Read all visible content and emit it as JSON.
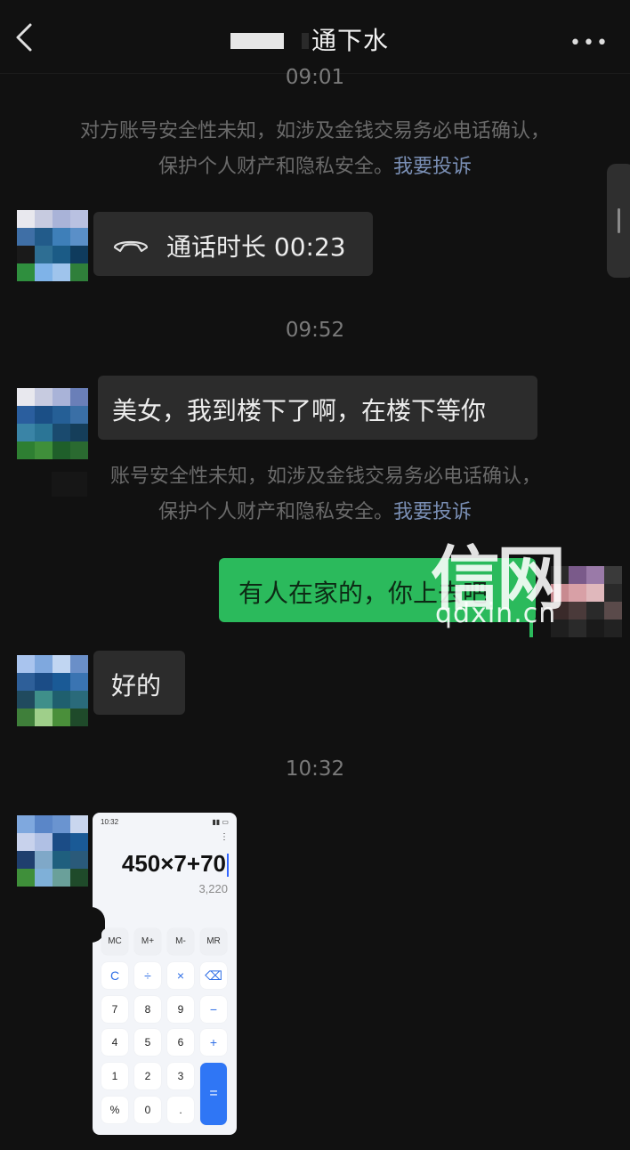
{
  "header": {
    "title": "通下水",
    "more_label": "•••"
  },
  "timestamps": [
    "09:01",
    "09:52",
    "10:32"
  ],
  "notice_1": {
    "line1": "对方账号安全性未知，如涉及金钱交易务必电话确认，",
    "line2_prefix": "保护个人财产和隐私安全。",
    "link": "我要投诉"
  },
  "notice_2": {
    "line1": "账号安全性未知，如涉及金钱交易务必电话确认，",
    "line2_prefix": "保护个人财产和隐私安全。",
    "link": "我要投诉"
  },
  "messages": [
    {
      "side": "left",
      "type": "call",
      "text": "通话时长 00:23"
    },
    {
      "side": "left",
      "type": "text",
      "text": "美女，我到楼下了啊，在楼下等你"
    },
    {
      "side": "right",
      "type": "text",
      "text": "有人在家的，你上去吧"
    },
    {
      "side": "left",
      "type": "text",
      "text": "好的"
    },
    {
      "side": "left",
      "type": "image",
      "text": ""
    }
  ],
  "watermark": {
    "big": "信网",
    "small": "qdxin.cn"
  },
  "calculator": {
    "status_time": "10:32",
    "status_icons": "▮▮ ▭",
    "menu": "⋮",
    "expression": "450×7+70",
    "result": "3,220",
    "keys": [
      [
        "MC",
        "M+",
        "M-",
        "MR"
      ],
      [
        "C",
        "÷",
        "×",
        "⌫"
      ],
      [
        "7",
        "8",
        "9",
        "−"
      ],
      [
        "4",
        "5",
        "6",
        "+"
      ],
      [
        "1",
        "2",
        "3",
        "="
      ],
      [
        "%",
        "0",
        "."
      ]
    ]
  },
  "colors": {
    "background": "#111111",
    "bubble_received": "#2c2c2c",
    "bubble_sent": "#2bba5c",
    "link": "#7a8fb5"
  }
}
